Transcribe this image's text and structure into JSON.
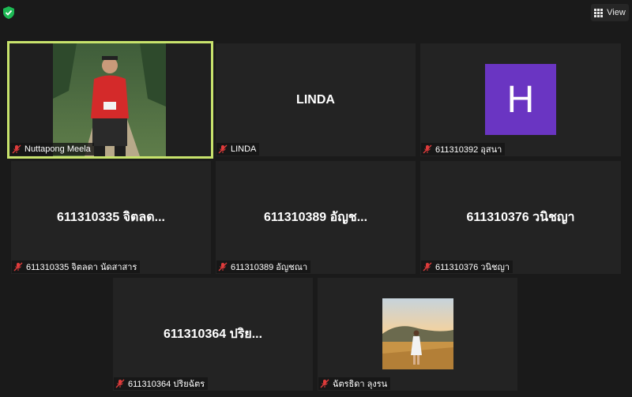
{
  "toolbar": {
    "view_label": "View",
    "shield_icon": "shield-check-icon",
    "view_icon": "grid-icon"
  },
  "colors": {
    "active_speaker_border": "#c8e36c",
    "mic_muted": "#e03b3b",
    "avatar_bg": "#6a35c2",
    "tile_bg": "#232323"
  },
  "participants": [
    {
      "label": "Nuttapong Meela",
      "display": "video",
      "active_speaker": true,
      "muted": true
    },
    {
      "label": "LINDA",
      "display": "name",
      "center_text": "LINDA",
      "muted": true
    },
    {
      "label": "611310392 อุสนา",
      "display": "avatar",
      "avatar_letter": "H",
      "muted": true
    },
    {
      "label": "611310335 จิตลดา นัดสาสาร",
      "display": "name",
      "center_text": "611310335 จิตลด...",
      "muted": true
    },
    {
      "label": "611310389 อัญชณา",
      "display": "name",
      "center_text": "611310389 อัญช...",
      "muted": true
    },
    {
      "label": "611310376 วนิชญา",
      "display": "name",
      "center_text": "611310376 วนิชญา",
      "muted": true
    },
    {
      "label": "611310364 ปริยฉัตร",
      "display": "name",
      "center_text": "611310364 ปริย...",
      "muted": true
    },
    {
      "label": "ฉัตรธิดา ลุงรน",
      "display": "photo",
      "muted": true
    }
  ]
}
